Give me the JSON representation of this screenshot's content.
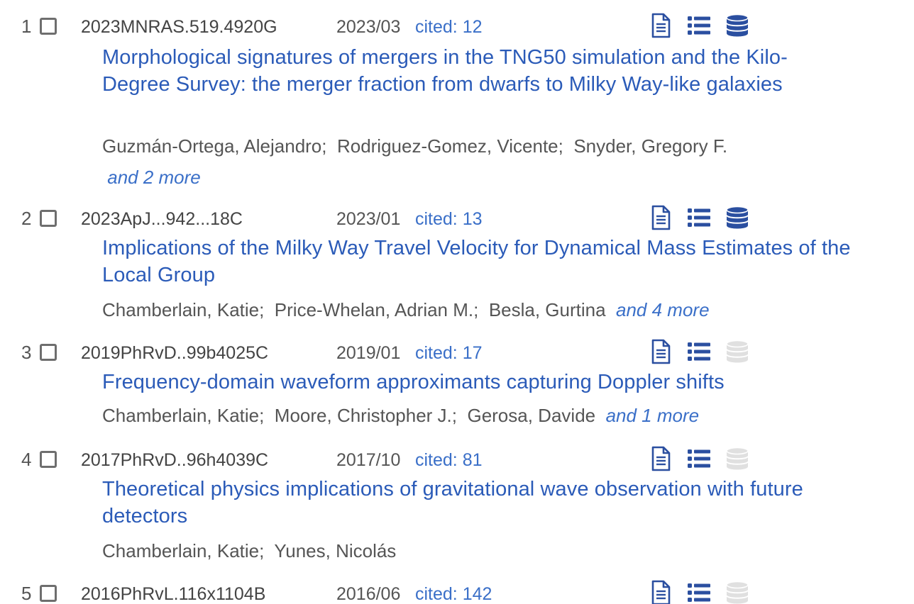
{
  "results": [
    {
      "index": "1",
      "bibcode": "2023MNRAS.519.4920G",
      "date": "2023/03",
      "cited": "cited: 12",
      "title": "Morphological signatures of mergers in the TNG50 simulation and the Kilo-Degree Survey: the merger fraction from dwarfs to Milky Way-like galaxies",
      "authors": [
        "Guzmán-Ortega, Alejandro;",
        "Rodriguez-Gomez, Vicente;",
        "Snyder, Gregory F."
      ],
      "more": "and 2 more",
      "data_available": true
    },
    {
      "index": "2",
      "bibcode": "2023ApJ...942...18C",
      "date": "2023/01",
      "cited": "cited: 13",
      "title": "Implications of the Milky Way Travel Velocity for Dynamical Mass Estimates of the Local Group",
      "authors": [
        "Chamberlain, Katie;",
        "Price-Whelan, Adrian M.;",
        "Besla, Gurtina"
      ],
      "more": "and 4 more",
      "data_available": true
    },
    {
      "index": "3",
      "bibcode": "2019PhRvD..99b4025C",
      "date": "2019/01",
      "cited": "cited: 17",
      "title": "Frequency-domain waveform approximants capturing Doppler shifts",
      "authors": [
        "Chamberlain, Katie;",
        "Moore, Christopher J.;",
        "Gerosa, Davide"
      ],
      "more": "and 1 more",
      "data_available": false
    },
    {
      "index": "4",
      "bibcode": "2017PhRvD..96h4039C",
      "date": "2017/10",
      "cited": "cited: 81",
      "title": "Theoretical physics implications of gravitational wave observation with future detectors",
      "authors": [
        "Chamberlain, Katie;",
        "Yunes, Nicolás"
      ],
      "more": "",
      "data_available": false
    },
    {
      "index": "5",
      "bibcode": "2016PhRvL.116x1104B",
      "date": "2016/06",
      "cited": "cited: 142",
      "title": "",
      "authors": [],
      "more": "",
      "data_available": false
    }
  ],
  "icons": {
    "full_text": "document-icon",
    "references": "list-icon",
    "data": "database-icon"
  },
  "colors": {
    "link": "#2b5bb8",
    "icon_active": "#2b4fa0",
    "icon_inactive": "#e0e0e0",
    "text": "#555555"
  }
}
